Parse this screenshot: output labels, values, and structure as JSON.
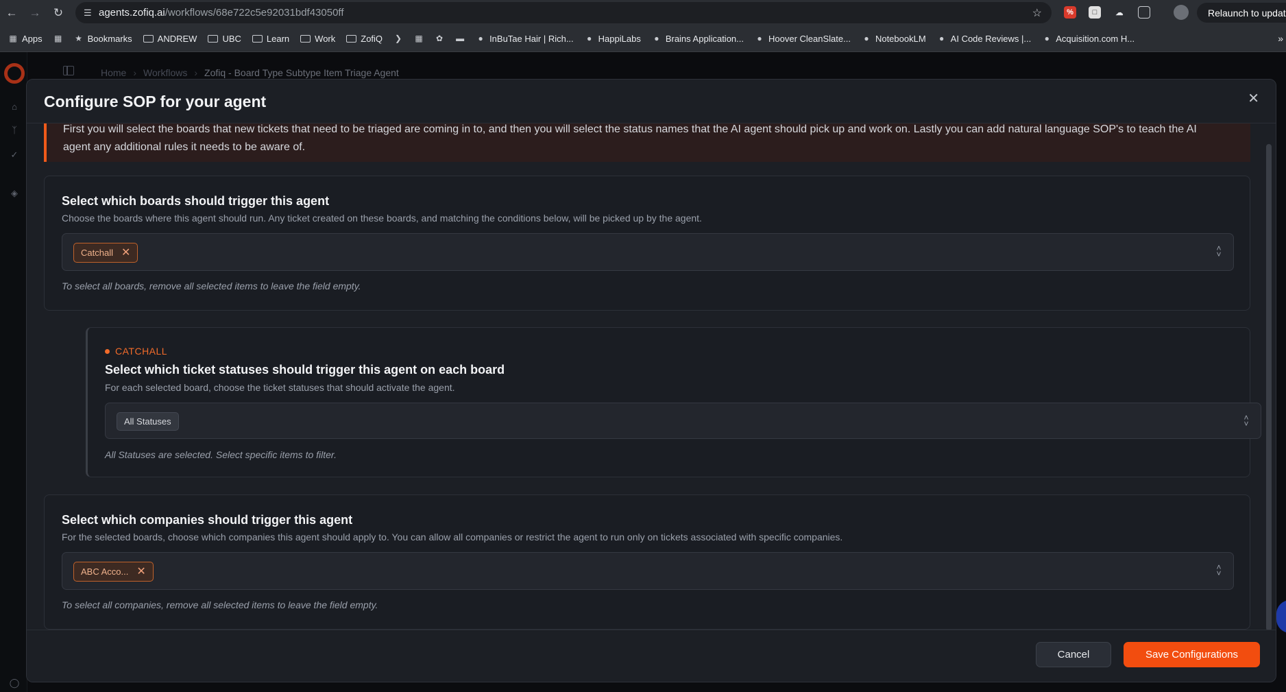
{
  "browser": {
    "url_host": "agents.zofiq.ai",
    "url_path": "/workflows/68e722c5e92031bdf43050ff",
    "relaunch_label": "Relaunch to update",
    "bookmarks": [
      {
        "label": "Apps",
        "icon": "apps-grid-icon"
      },
      {
        "label": "",
        "icon": "grid-icon"
      },
      {
        "label": "Bookmarks",
        "icon": "star-icon"
      },
      {
        "label": "ANDREW",
        "icon": "folder-icon"
      },
      {
        "label": "UBC",
        "icon": "folder-icon"
      },
      {
        "label": "Learn",
        "icon": "folder-icon"
      },
      {
        "label": "Work",
        "icon": "folder-icon"
      },
      {
        "label": "ZofiQ",
        "icon": "folder-icon"
      },
      {
        "label": "",
        "icon": "leaf-icon"
      },
      {
        "label": "",
        "icon": "columns-icon"
      },
      {
        "label": "",
        "icon": "bug-icon"
      },
      {
        "label": "",
        "icon": "car-icon"
      },
      {
        "label": "InBuTae Hair | Rich...",
        "icon": "site-icon"
      },
      {
        "label": "HappiLabs",
        "icon": "site-icon"
      },
      {
        "label": "Brains Application...",
        "icon": "site-icon"
      },
      {
        "label": "Hoover CleanSlate...",
        "icon": "site-icon"
      },
      {
        "label": "NotebookLM",
        "icon": "site-icon"
      },
      {
        "label": "AI Code Reviews |...",
        "icon": "site-icon"
      },
      {
        "label": "Acquisition.com H...",
        "icon": "site-icon"
      }
    ]
  },
  "app": {
    "breadcrumb": [
      "Home",
      "Workflows",
      "Zofiq - Board Type Subtype Item Triage Agent"
    ]
  },
  "modal": {
    "title": "Configure SOP for your agent",
    "banner_line1": "First you will select the boards that new tickets that need to be triaged are coming in to, and then you will select the status names that the AI agent should pick up and work on. Lastly you can add natural language SOP's to teach the AI",
    "banner_line2": "agent any additional rules it needs to be aware of.",
    "boards": {
      "title": "Select which boards should trigger this agent",
      "description": "Choose the boards where this agent should run. Any ticket created on these boards, and matching the conditions below, will be picked up by the agent.",
      "selected": [
        "Catchall"
      ],
      "hint": "To select all boards, remove all selected items to leave the field empty."
    },
    "statuses": {
      "board_tag": "CATCHALL",
      "title": "Select which ticket statuses should trigger this agent on each board",
      "description": "For each selected board, choose the ticket statuses that should activate the agent.",
      "selected": [
        "All Statuses"
      ],
      "hint": "All Statuses are selected. Select specific items to filter."
    },
    "companies": {
      "title": "Select which companies should trigger this agent",
      "description": "For the selected boards, choose which companies this agent should apply to. You can allow all companies or restrict the agent to run only on tickets associated with specific companies.",
      "selected": [
        "ABC Acco..."
      ],
      "hint": "To select all companies, remove all selected items to leave the field empty."
    },
    "footer": {
      "cancel_label": "Cancel",
      "save_label": "Save Configurations"
    }
  },
  "colors": {
    "accent": "#f24d0f",
    "modal_bg": "#1c1f25",
    "page_bg": "#0f1115"
  }
}
